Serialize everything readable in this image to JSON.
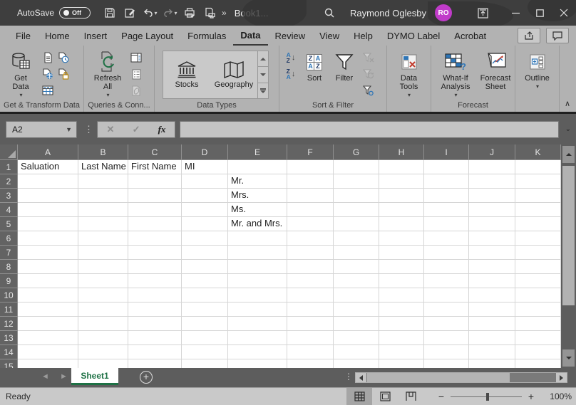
{
  "titlebar": {
    "autosave_label": "AutoSave",
    "autosave_state": "Off",
    "overflow_glyph": "»",
    "document_title": "Book1...",
    "user_name": "Raymond Oglesby",
    "user_initials": "RO"
  },
  "tabs": {
    "items": [
      "File",
      "Home",
      "Insert",
      "Page Layout",
      "Formulas",
      "Data",
      "Review",
      "View",
      "Help",
      "DYMO Label",
      "Acrobat"
    ],
    "active": "Data"
  },
  "ribbon": {
    "get_transform": {
      "label": "Get & Transform Data",
      "get_data": "Get Data"
    },
    "queries": {
      "label": "Queries & Conn...",
      "refresh_all": "Refresh All"
    },
    "data_types": {
      "label": "Data Types",
      "stocks": "Stocks",
      "geography": "Geography"
    },
    "sort_filter": {
      "label": "Sort & Filter",
      "sort": "Sort",
      "filter": "Filter"
    },
    "data_tools": {
      "button": "Data Tools"
    },
    "forecast": {
      "label": "Forecast",
      "what_if": "What-If Analysis",
      "forecast_sheet": "Forecast Sheet"
    },
    "outline": {
      "button": "Outline"
    }
  },
  "formula_bar": {
    "name_box": "A2",
    "fx_glyph": "fx",
    "value": ""
  },
  "grid": {
    "columns": [
      "A",
      "B",
      "C",
      "D",
      "E",
      "F",
      "G",
      "H",
      "I",
      "J",
      "K"
    ],
    "row_count": 15,
    "cells": {
      "A1": "Saluation",
      "B1": "Last Name",
      "C1": "First Name",
      "D1": "MI",
      "E2": "Mr.",
      "E3": "Mrs.",
      "E4": "Ms.",
      "E5": "Mr. and Mrs."
    }
  },
  "sheet_bar": {
    "active_tab": "Sheet1"
  },
  "status_bar": {
    "status": "Ready",
    "zoom_level": "100%"
  },
  "colors": {
    "accent_green": "#1e7145",
    "avatar_magenta": "#c03bc9",
    "accent_blue": "#2e75b6"
  }
}
